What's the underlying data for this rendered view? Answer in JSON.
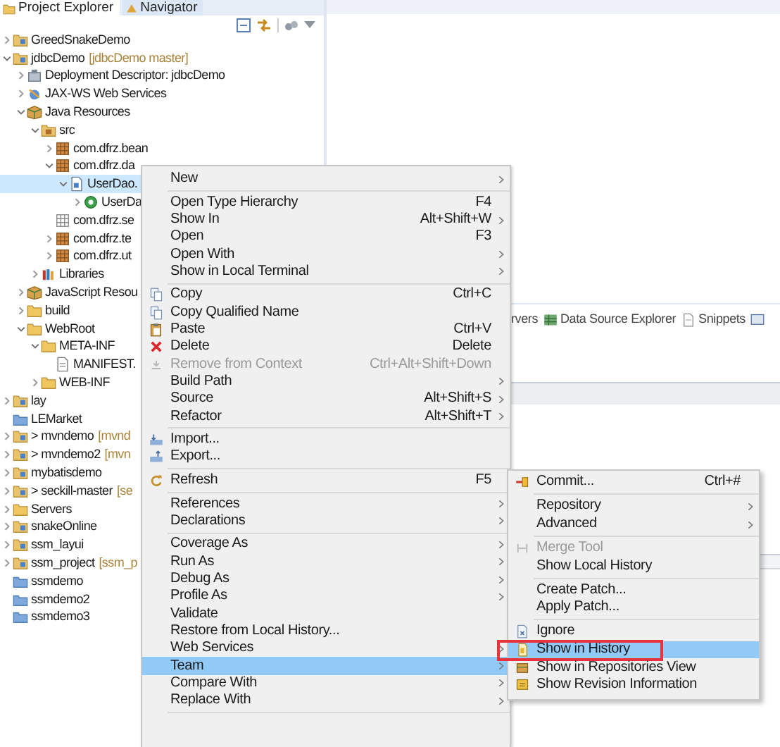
{
  "explorer": {
    "tabs": [
      {
        "label": "Project Explorer",
        "selected": true
      },
      {
        "label": "Navigator",
        "selected": false
      }
    ],
    "tree": [
      {
        "label": "GreedSnakeDemo",
        "kind": "project",
        "expanded": false,
        "selected": false
      },
      {
        "label": "jdbcDemo",
        "decoration": "[jdbcDemo master]",
        "kind": "project",
        "expanded": true,
        "selected": false,
        "children": [
          {
            "label": "Deployment Descriptor: jdbcDemo",
            "kind": "descriptor",
            "expanded": false,
            "selected": false
          },
          {
            "label": "JAX-WS Web Services",
            "kind": "web-services",
            "expanded": false,
            "selected": false
          },
          {
            "label": "Java Resources",
            "kind": "box",
            "expanded": true,
            "selected": false,
            "children": [
              {
                "label": "src",
                "kind": "src-folder",
                "expanded": true,
                "selected": false,
                "children": [
                  {
                    "label": "com.dfrz.bean",
                    "kind": "package",
                    "expanded": false,
                    "selected": false
                  },
                  {
                    "label": "com.dfrz.da",
                    "kind": "package",
                    "expanded": true,
                    "selected": false,
                    "children": [
                      {
                        "label": "UserDao.",
                        "kind": "java-file",
                        "expanded": true,
                        "selected": true,
                        "children": [
                          {
                            "label": "UserDa",
                            "kind": "class",
                            "expanded": false,
                            "selected": false
                          }
                        ]
                      }
                    ]
                  },
                  {
                    "label": "com.dfrz.se",
                    "kind": "empty-package",
                    "selected": false
                  },
                  {
                    "label": "com.dfrz.te",
                    "kind": "package",
                    "expanded": false,
                    "selected": false
                  },
                  {
                    "label": "com.dfrz.ut",
                    "kind": "package",
                    "expanded": false,
                    "selected": false
                  }
                ]
              },
              {
                "label": "Libraries",
                "kind": "library",
                "expanded": false,
                "selected": false
              }
            ]
          },
          {
            "label": "JavaScript Resou",
            "kind": "box",
            "expanded": false,
            "selected": false
          },
          {
            "label": "build",
            "kind": "folder",
            "expanded": false,
            "selected": false
          },
          {
            "label": "WebRoot",
            "kind": "folder",
            "expanded": true,
            "selected": false,
            "children": [
              {
                "label": "META-INF",
                "kind": "folder",
                "expanded": true,
                "selected": false,
                "children": [
                  {
                    "label": "MANIFEST.",
                    "kind": "file",
                    "selected": false
                  }
                ]
              },
              {
                "label": "WEB-INF",
                "kind": "folder",
                "expanded": false,
                "selected": false
              }
            ]
          }
        ]
      },
      {
        "label": "lay",
        "kind": "project",
        "expanded": false,
        "selected": false
      },
      {
        "label": "LEMarket",
        "kind": "closed-project",
        "selected": false
      },
      {
        "label": "> mvndemo",
        "decoration": "[mvnd",
        "kind": "project",
        "expanded": false,
        "selected": false
      },
      {
        "label": "> mvndemo2",
        "decoration": "[mvn",
        "kind": "project",
        "expanded": false,
        "selected": false
      },
      {
        "label": "mybatisdemo",
        "kind": "project",
        "expanded": false,
        "selected": false
      },
      {
        "label": "> seckill-master",
        "decoration": "[se",
        "kind": "project",
        "expanded": false,
        "selected": false
      },
      {
        "label": "Servers",
        "kind": "folder",
        "expanded": false,
        "selected": false
      },
      {
        "label": "snakeOnline",
        "kind": "project",
        "expanded": false,
        "selected": false
      },
      {
        "label": "ssm_layui",
        "kind": "project",
        "expanded": false,
        "selected": false
      },
      {
        "label": "ssm_project",
        "decoration": "[ssm_p",
        "kind": "project",
        "expanded": false,
        "selected": false
      },
      {
        "label": "ssmdemo",
        "kind": "closed-project",
        "selected": false
      },
      {
        "label": "ssmdemo2",
        "kind": "closed-project",
        "selected": false
      },
      {
        "label": "ssmdemo3",
        "kind": "closed-project",
        "selected": false
      }
    ]
  },
  "bottom_panel": {
    "tabs": [
      {
        "label": "rvers",
        "kind": "plain"
      },
      {
        "label": "Data Source Explorer",
        "kind": "database"
      },
      {
        "label": "Snippets",
        "kind": "snippets"
      }
    ]
  },
  "context_menu": {
    "items": [
      {
        "kind": "item",
        "label": "New",
        "submenu": true,
        "disabled": false,
        "selected": false
      },
      {
        "kind": "separator"
      },
      {
        "kind": "item",
        "label": "Open Type Hierarchy",
        "shortcut": "F4",
        "submenu": false,
        "disabled": false,
        "selected": false
      },
      {
        "kind": "item",
        "label": "Show In",
        "shortcut": "Alt+Shift+W",
        "submenu": true,
        "disabled": false,
        "selected": false
      },
      {
        "kind": "item",
        "label": "Open",
        "shortcut": "F3",
        "submenu": false,
        "disabled": false,
        "selected": false
      },
      {
        "kind": "item",
        "label": "Open With",
        "submenu": true,
        "disabled": false,
        "selected": false
      },
      {
        "kind": "item",
        "label": "Show in Local Terminal",
        "submenu": true,
        "disabled": false,
        "selected": false
      },
      {
        "kind": "separator"
      },
      {
        "kind": "item",
        "label": "Copy",
        "shortcut": "Ctrl+C",
        "submenu": false,
        "disabled": false,
        "selected": false
      },
      {
        "kind": "item",
        "label": "Copy Qualified Name",
        "submenu": false,
        "disabled": false,
        "selected": false
      },
      {
        "kind": "item",
        "label": "Paste",
        "shortcut": "Ctrl+V",
        "submenu": false,
        "disabled": false,
        "selected": false
      },
      {
        "kind": "item",
        "label": "Delete",
        "shortcut": "Delete",
        "submenu": false,
        "disabled": false,
        "selected": false
      },
      {
        "kind": "item",
        "label": "Remove from Context",
        "shortcut": "Ctrl+Alt+Shift+Down",
        "submenu": false,
        "disabled": true,
        "selected": false
      },
      {
        "kind": "item",
        "label": "Build Path",
        "submenu": true,
        "disabled": false,
        "selected": false
      },
      {
        "kind": "item",
        "label": "Source",
        "shortcut": "Alt+Shift+S",
        "submenu": true,
        "disabled": false,
        "selected": false
      },
      {
        "kind": "item",
        "label": "Refactor",
        "shortcut": "Alt+Shift+T",
        "submenu": true,
        "disabled": false,
        "selected": false
      },
      {
        "kind": "separator"
      },
      {
        "kind": "item",
        "label": "Import...",
        "submenu": false,
        "disabled": false,
        "selected": false
      },
      {
        "kind": "item",
        "label": "Export...",
        "submenu": false,
        "disabled": false,
        "selected": false
      },
      {
        "kind": "separator"
      },
      {
        "kind": "item",
        "label": "Refresh",
        "shortcut": "F5",
        "submenu": false,
        "disabled": false,
        "selected": false
      },
      {
        "kind": "separator"
      },
      {
        "kind": "item",
        "label": "References",
        "submenu": true,
        "disabled": false,
        "selected": false
      },
      {
        "kind": "item",
        "label": "Declarations",
        "submenu": true,
        "disabled": false,
        "selected": false
      },
      {
        "kind": "separator"
      },
      {
        "kind": "item",
        "label": "Coverage As",
        "submenu": true,
        "disabled": false,
        "selected": false
      },
      {
        "kind": "item",
        "label": "Run As",
        "submenu": true,
        "disabled": false,
        "selected": false
      },
      {
        "kind": "item",
        "label": "Debug As",
        "submenu": true,
        "disabled": false,
        "selected": false
      },
      {
        "kind": "item",
        "label": "Profile As",
        "submenu": true,
        "disabled": false,
        "selected": false
      },
      {
        "kind": "item",
        "label": "Validate",
        "submenu": false,
        "disabled": false,
        "selected": false
      },
      {
        "kind": "item",
        "label": "Restore from Local History...",
        "submenu": false,
        "disabled": false,
        "selected": false
      },
      {
        "kind": "item",
        "label": "Web Services",
        "submenu": true,
        "disabled": false,
        "selected": false
      },
      {
        "kind": "item",
        "label": "Team",
        "submenu": true,
        "disabled": false,
        "selected": true
      },
      {
        "kind": "item",
        "label": "Compare With",
        "submenu": true,
        "disabled": false,
        "selected": false
      },
      {
        "kind": "item",
        "label": "Replace With",
        "submenu": true,
        "disabled": false,
        "selected": false
      },
      {
        "kind": "separator"
      }
    ]
  },
  "team_submenu": {
    "items": [
      {
        "kind": "item",
        "label": "Commit...",
        "shortcut": "Ctrl+#",
        "submenu": false,
        "disabled": false,
        "selected": false,
        "outlined": false
      },
      {
        "kind": "separator"
      },
      {
        "kind": "item",
        "label": "Repository",
        "submenu": true,
        "disabled": false,
        "selected": false,
        "outlined": false
      },
      {
        "kind": "item",
        "label": "Advanced",
        "submenu": true,
        "disabled": false,
        "selected": false,
        "outlined": false
      },
      {
        "kind": "separator"
      },
      {
        "kind": "item",
        "label": "Merge Tool",
        "submenu": false,
        "disabled": true,
        "selected": false,
        "outlined": false
      },
      {
        "kind": "item",
        "label": "Show Local History",
        "submenu": false,
        "disabled": false,
        "selected": false,
        "outlined": false
      },
      {
        "kind": "separator"
      },
      {
        "kind": "item",
        "label": "Create Patch...",
        "submenu": false,
        "disabled": false,
        "selected": false,
        "outlined": false
      },
      {
        "kind": "item",
        "label": "Apply Patch...",
        "submenu": false,
        "disabled": false,
        "selected": false,
        "outlined": false
      },
      {
        "kind": "separator"
      },
      {
        "kind": "item",
        "label": "Ignore",
        "submenu": false,
        "disabled": false,
        "selected": false,
        "outlined": false
      },
      {
        "kind": "item",
        "label": "Show in History",
        "submenu": false,
        "disabled": false,
        "selected": true,
        "outlined": true
      },
      {
        "kind": "item",
        "label": "Show in Repositories View",
        "submenu": false,
        "disabled": false,
        "selected": false,
        "outlined": false
      },
      {
        "kind": "item",
        "label": "Show Revision Information",
        "submenu": false,
        "disabled": false,
        "selected": false,
        "outlined": false
      }
    ]
  }
}
